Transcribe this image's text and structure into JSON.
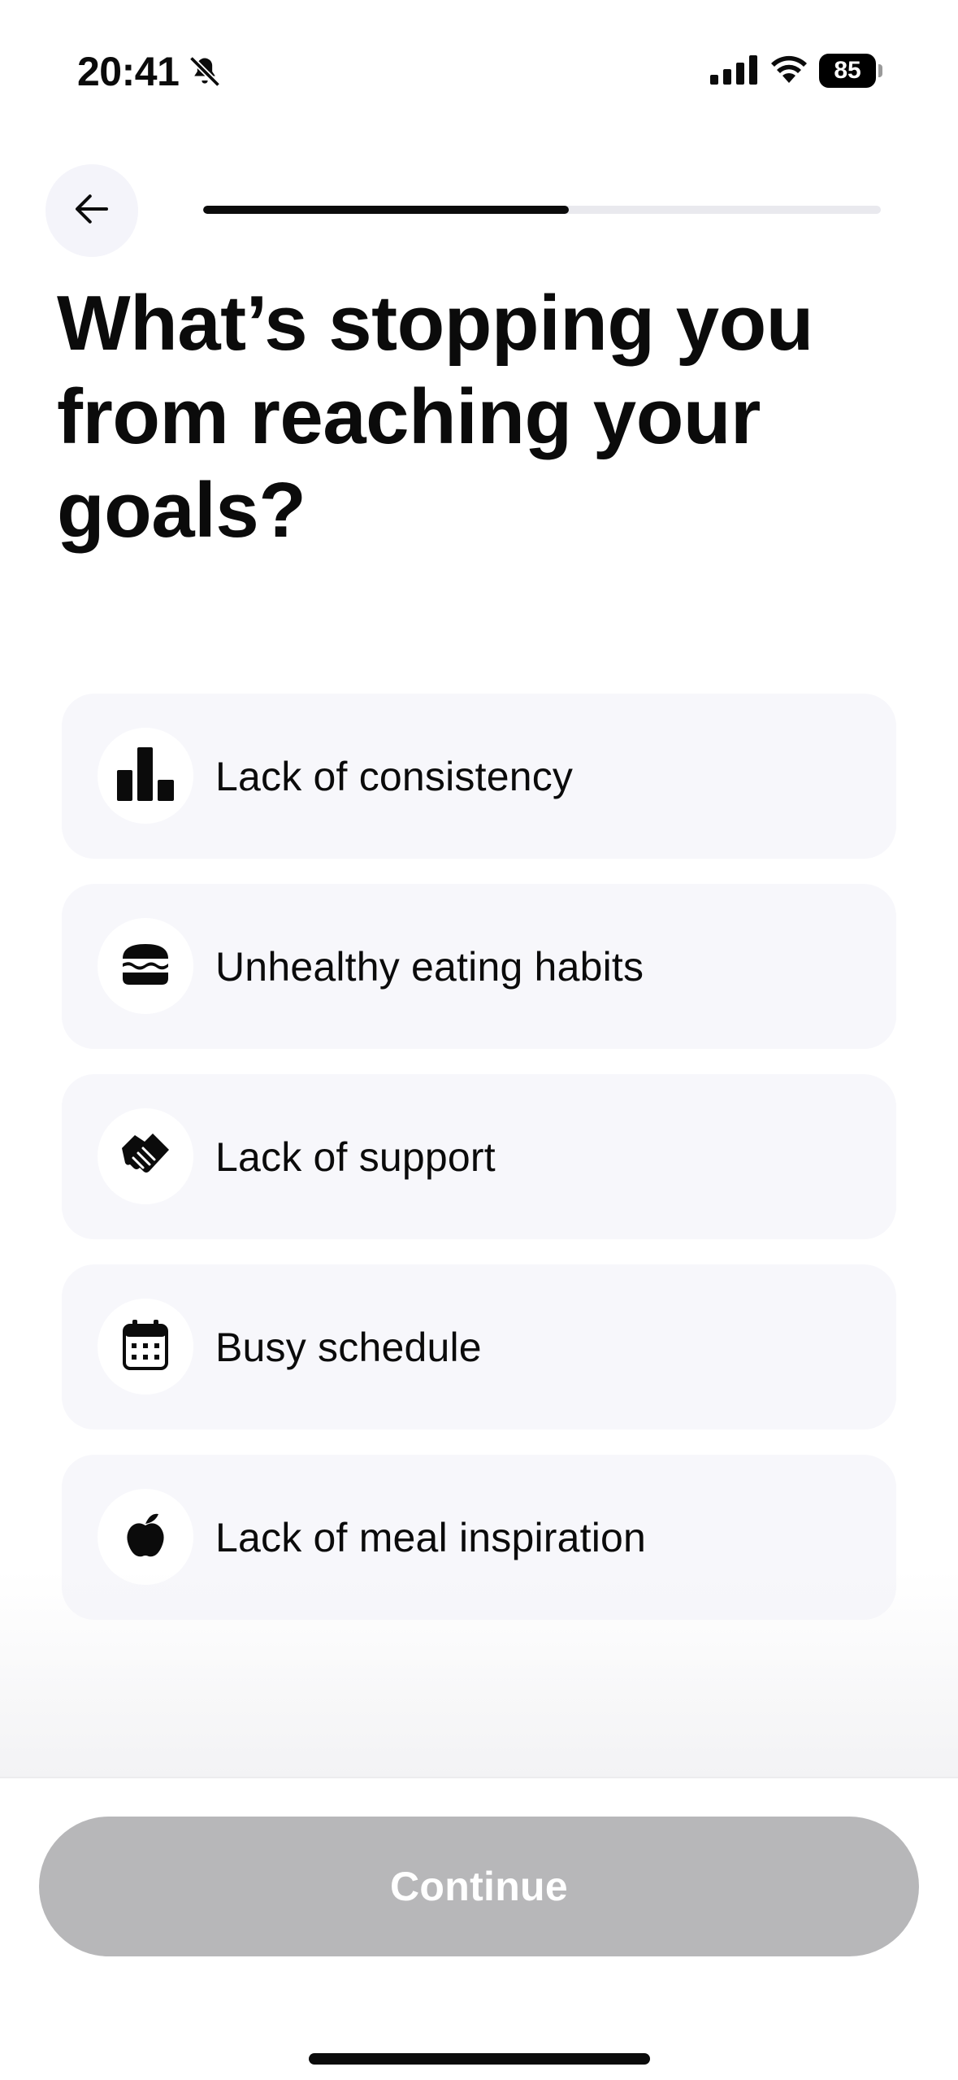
{
  "status_bar": {
    "time": "20:41",
    "battery_level": "85",
    "icons": [
      "bell-slash-icon",
      "cellular-signal-icon",
      "wifi-icon",
      "battery-icon"
    ]
  },
  "header": {
    "back_icon": "arrow-left-icon",
    "progress_fraction": 0.54
  },
  "question": {
    "title": "What’s stopping you from reaching your goals?"
  },
  "options": [
    {
      "label": "Lack of consistency",
      "icon": "bar-chart-icon"
    },
    {
      "label": "Unhealthy eating habits",
      "icon": "burger-icon"
    },
    {
      "label": "Lack of support",
      "icon": "handshake-icon"
    },
    {
      "label": "Busy schedule",
      "icon": "calendar-icon"
    },
    {
      "label": "Lack of meal inspiration",
      "icon": "apple-icon"
    }
  ],
  "footer": {
    "continue_label": "Continue"
  },
  "colors": {
    "text": "#0b0b0b",
    "option_bg": "#f7f7fb",
    "button_disabled": "#b7b7b9",
    "progress_track": "#e9e9ee"
  }
}
